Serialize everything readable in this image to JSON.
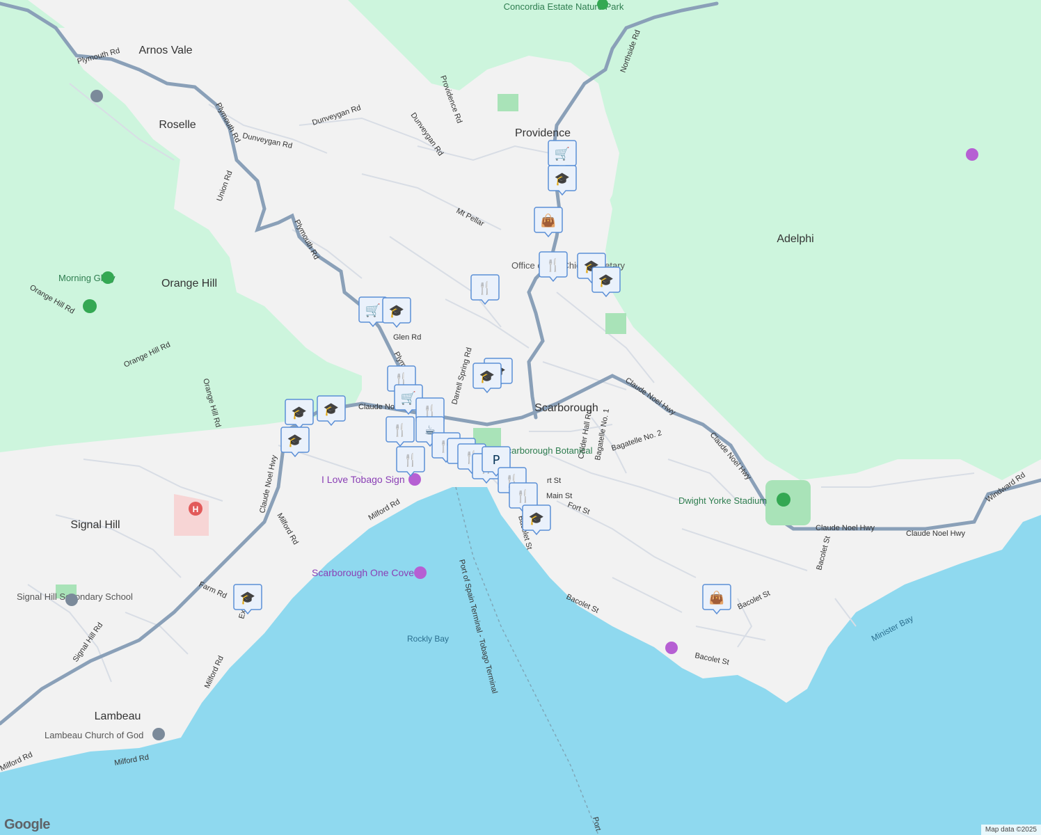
{
  "map": {
    "towns": [
      "Arnos Vale",
      "Roselle",
      "Providence",
      "Orange Hill",
      "Adelphi",
      "Scarborough",
      "Signal Hill",
      "Lambeau"
    ],
    "roads": [
      "Plymouth Rd",
      "Plymouth Rd",
      "Dunveygan Rd",
      "Dunveygan Rd",
      "Dunveygan Rd",
      "Providence Rd",
      "Northside Rd",
      "Union Rd",
      "Plymouth Rd",
      "Mt Pellar",
      "Orange Hill Rd",
      "Orange Hill Rd",
      "Orange Hill Rd",
      "Glen Rd",
      "Plym",
      "Darrell Spring Rd",
      "Claude No",
      "Claude Noel Hwy",
      "Claude Noel Hwy",
      "Claude Noel Hwy",
      "Claude Noel Hwy",
      "Claude Noel Hwy",
      "Calder Hall Rd",
      "Bagatelle No. 1",
      "Bagatelle No. 2",
      "Milford Rd",
      "Milford Rd",
      "Milford Rd",
      "Milford Rd",
      "Milford Rd",
      "Main St",
      "Fort St",
      "Bacolet St",
      "Bacolet St",
      "Bacolet St",
      "Bacolet St",
      "Bacolet St",
      "Windward Rd",
      "Farm Rd",
      "Signal Hill Rd",
      "Ext",
      "rt St",
      "Port of Spain Terminal - Tobago Terminal",
      "Port"
    ],
    "pois": [
      {
        "name": "Concordia Estate Nature Park",
        "kind": "park-icon"
      },
      {
        "name": "Morning Glory",
        "kind": "park-icon"
      },
      {
        "name": "Office of the Chief Secretary",
        "kind": "government"
      },
      {
        "name": "Dwight Yorke Stadium",
        "kind": "stadium-icon"
      },
      {
        "name": "I Love Tobago Sign",
        "kind": "camera-icon"
      },
      {
        "name": "Scarborough One Cove",
        "kind": "camera-icon"
      },
      {
        "name": "Signal Hill Secondary School",
        "kind": "school-icon"
      },
      {
        "name": "Lambeau Church of God",
        "kind": "church-icon"
      },
      {
        "name": "Scarborough Botanical",
        "kind": "garden"
      }
    ],
    "water": [
      "Rockly Bay",
      "Minister Bay"
    ],
    "logo": "Google",
    "attribution": "Map data ©2025"
  }
}
